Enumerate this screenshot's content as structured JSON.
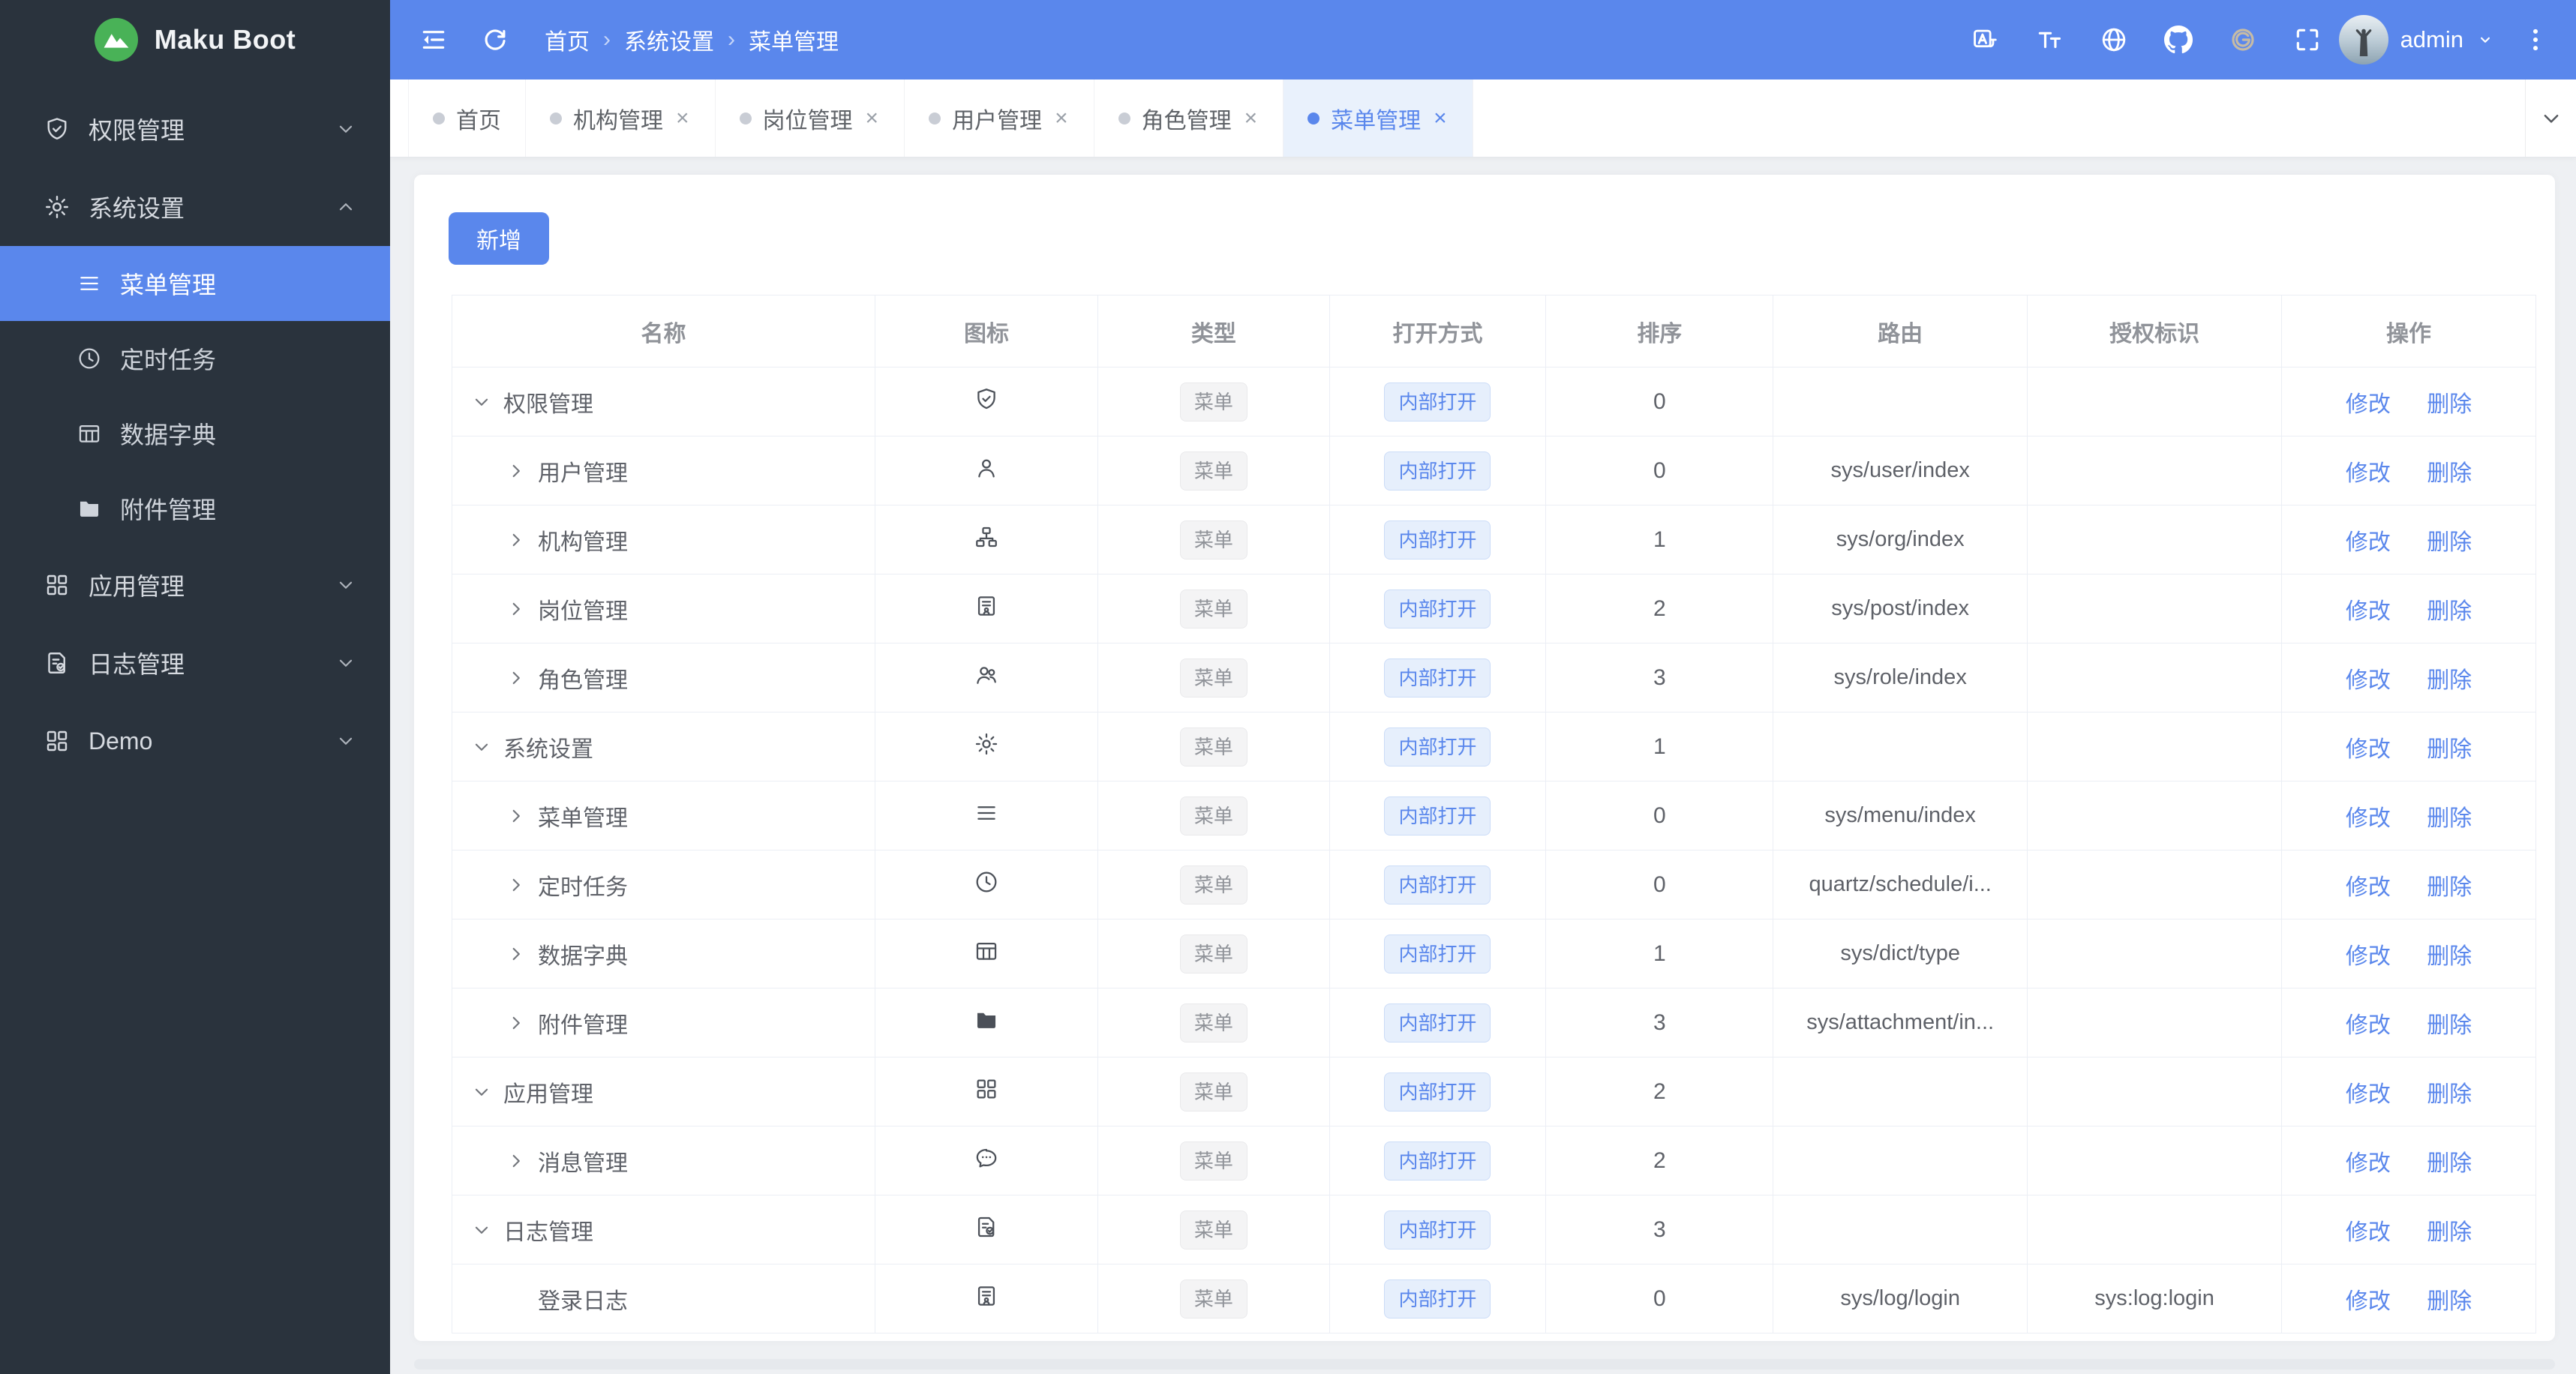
{
  "sidebar": {
    "logo_text": "Maku Boot",
    "items": [
      {
        "label": "权限管理",
        "icon": "shield-check",
        "state": "collapsed"
      },
      {
        "label": "系统设置",
        "icon": "gear",
        "state": "expanded",
        "children": [
          {
            "label": "菜单管理",
            "icon": "menu-lines",
            "active": true
          },
          {
            "label": "定时任务",
            "icon": "clock",
            "active": false
          },
          {
            "label": "数据字典",
            "icon": "dict-table",
            "active": false
          },
          {
            "label": "附件管理",
            "icon": "folder",
            "active": false
          }
        ]
      },
      {
        "label": "应用管理",
        "icon": "grid",
        "state": "collapsed"
      },
      {
        "label": "日志管理",
        "icon": "doc-check",
        "state": "collapsed"
      },
      {
        "label": "Demo",
        "icon": "grid-alt",
        "state": "collapsed"
      }
    ]
  },
  "header": {
    "left_tools": [
      "collapse-menu",
      "refresh"
    ],
    "breadcrumb": [
      "首页",
      "系统设置",
      "菜单管理"
    ],
    "tools": [
      "translate",
      "font-size",
      "globe",
      "github",
      "gitee",
      "fullscreen"
    ],
    "user": "admin"
  },
  "tabs": [
    {
      "label": "首页",
      "closable": false,
      "active": false
    },
    {
      "label": "机构管理",
      "closable": true,
      "active": false
    },
    {
      "label": "岗位管理",
      "closable": true,
      "active": false
    },
    {
      "label": "用户管理",
      "closable": true,
      "active": false
    },
    {
      "label": "角色管理",
      "closable": true,
      "active": false
    },
    {
      "label": "菜单管理",
      "closable": true,
      "active": true
    }
  ],
  "content": {
    "add_label": "新增",
    "table": {
      "columns": [
        "名称",
        "图标",
        "类型",
        "打开方式",
        "排序",
        "路由",
        "授权标识",
        "操作"
      ],
      "action_edit": "修改",
      "action_delete": "删除",
      "rows": [
        {
          "name": "权限管理",
          "level": 0,
          "expand": "down",
          "icon": "shield-check",
          "type": "菜单",
          "open_mode": "内部打开",
          "sort": "0",
          "route": "",
          "auth": ""
        },
        {
          "name": "用户管理",
          "level": 1,
          "expand": "right",
          "icon": "user",
          "type": "菜单",
          "open_mode": "内部打开",
          "sort": "0",
          "route": "sys/user/index",
          "auth": ""
        },
        {
          "name": "机构管理",
          "level": 1,
          "expand": "right",
          "icon": "org",
          "type": "菜单",
          "open_mode": "内部打开",
          "sort": "1",
          "route": "sys/org/index",
          "auth": ""
        },
        {
          "name": "岗位管理",
          "level": 1,
          "expand": "right",
          "icon": "post",
          "type": "菜单",
          "open_mode": "内部打开",
          "sort": "2",
          "route": "sys/post/index",
          "auth": ""
        },
        {
          "name": "角色管理",
          "level": 1,
          "expand": "right",
          "icon": "role",
          "type": "菜单",
          "open_mode": "内部打开",
          "sort": "3",
          "route": "sys/role/index",
          "auth": ""
        },
        {
          "name": "系统设置",
          "level": 0,
          "expand": "down",
          "icon": "gear",
          "type": "菜单",
          "open_mode": "内部打开",
          "sort": "1",
          "route": "",
          "auth": ""
        },
        {
          "name": "菜单管理",
          "level": 1,
          "expand": "right",
          "icon": "menu-lines",
          "type": "菜单",
          "open_mode": "内部打开",
          "sort": "0",
          "route": "sys/menu/index",
          "auth": ""
        },
        {
          "name": "定时任务",
          "level": 1,
          "expand": "right",
          "icon": "clock",
          "type": "菜单",
          "open_mode": "内部打开",
          "sort": "0",
          "route": "quartz/schedule/i...",
          "auth": ""
        },
        {
          "name": "数据字典",
          "level": 1,
          "expand": "right",
          "icon": "dict-table",
          "type": "菜单",
          "open_mode": "内部打开",
          "sort": "1",
          "route": "sys/dict/type",
          "auth": ""
        },
        {
          "name": "附件管理",
          "level": 1,
          "expand": "right",
          "icon": "folder-filled",
          "type": "菜单",
          "open_mode": "内部打开",
          "sort": "3",
          "route": "sys/attachment/in...",
          "auth": ""
        },
        {
          "name": "应用管理",
          "level": 0,
          "expand": "down",
          "icon": "grid",
          "type": "菜单",
          "open_mode": "内部打开",
          "sort": "2",
          "route": "",
          "auth": ""
        },
        {
          "name": "消息管理",
          "level": 1,
          "expand": "right",
          "icon": "chat",
          "type": "菜单",
          "open_mode": "内部打开",
          "sort": "2",
          "route": "",
          "auth": ""
        },
        {
          "name": "日志管理",
          "level": 0,
          "expand": "down",
          "icon": "doc-check",
          "type": "菜单",
          "open_mode": "内部打开",
          "sort": "3",
          "route": "",
          "auth": ""
        },
        {
          "name": "登录日志",
          "level": 1,
          "expand": "none",
          "icon": "post",
          "type": "菜单",
          "open_mode": "内部打开",
          "sort": "0",
          "route": "sys/log/login",
          "auth": "sys:log:login"
        }
      ]
    }
  },
  "colors": {
    "primary": "#5a87ec",
    "sidebar_bg": "#2a333d",
    "sidebar_active_bg": "#5a87ec",
    "content_bg": "#eef0f3",
    "card_bg": "#ffffff",
    "tab_active_bg": "#e9f1fc",
    "tag_gray_bg": "#f4f4f5",
    "tag_gray_text": "#909399",
    "tag_blue_bg": "#e6effc",
    "tag_blue_text": "#5a87ec",
    "link": "#5a87ec",
    "table_border": "#ebeef5",
    "logo_green": "#49b257",
    "gitee_icon": "#c6bba5"
  }
}
